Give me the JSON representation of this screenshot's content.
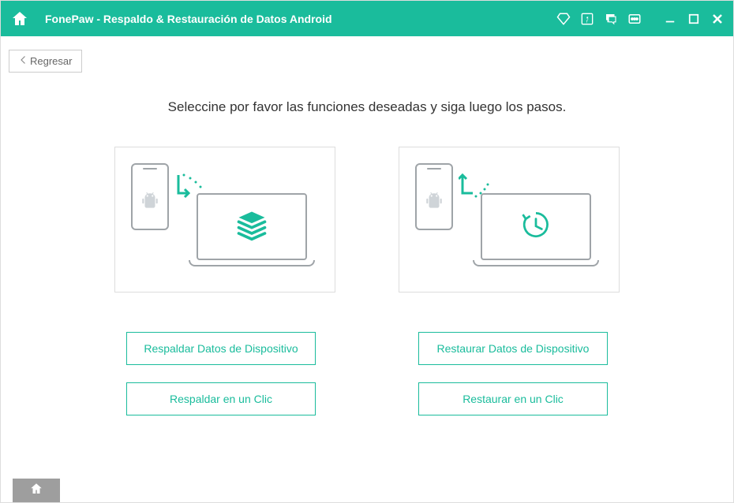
{
  "titlebar": {
    "title": "FonePaw -   Respaldo & Restauración de Datos Android"
  },
  "back_button": {
    "label": "Regresar"
  },
  "instruction": "Seleccine por favor las funciones deseadas y siga luego los pasos.",
  "buttons": {
    "backup_device": "Respaldar Datos de Dispositivo",
    "backup_one_click": "Respaldar en un Clic",
    "restore_device": "Restaurar Datos de Dispositivo",
    "restore_one_click": "Restaurar en un Clic"
  }
}
